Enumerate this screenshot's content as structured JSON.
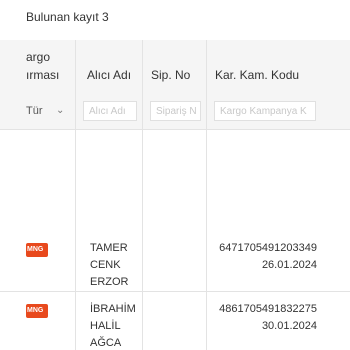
{
  "summary": {
    "record_count_text": "Bulunan kayıt 3"
  },
  "columns": {
    "cargo_firm_line1": "argo",
    "cargo_firm_line2": "ırması",
    "recipient_name": "Alıcı Adı",
    "order_no": "Sip. No",
    "campaign_code": "Kar. Kam. Kodu"
  },
  "filters": {
    "cargo_select_value": "Tür",
    "recipient_placeholder": "Alıcı Adı",
    "order_placeholder": "Sipariş N",
    "campaign_placeholder": "Kargo Kampanya K"
  },
  "rows": [
    {
      "cargo_badge": "MNG",
      "recipient_lines": [
        "TAMER",
        "CENK",
        "ERZOR"
      ],
      "order_no": "",
      "campaign_code": "6471705491203349",
      "date": "26.01.2024"
    },
    {
      "cargo_badge": "MNG",
      "recipient_lines": [
        "İBRAHİM",
        "HALİL",
        "AĞCA"
      ],
      "order_no": "",
      "campaign_code": "4861705491832275",
      "date": "30.01.2024"
    }
  ],
  "colors": {
    "header_bg": "#f5f5f5",
    "badge_bg": "#e8491d"
  },
  "icons": {
    "select_chevron": "chevron-down-icon"
  }
}
